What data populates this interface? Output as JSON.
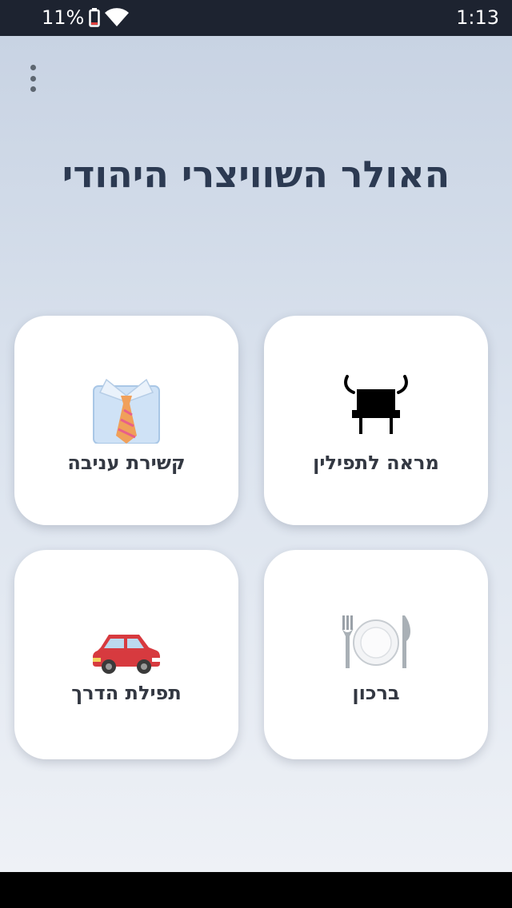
{
  "status_bar": {
    "battery_percent": "11%",
    "time": "1:13",
    "icons": [
      "battery-icon",
      "wifi-icon"
    ]
  },
  "app": {
    "title": "האולר השוויצרי היהודי",
    "menu_icon": "more-vert-icon"
  },
  "cards": [
    {
      "label": "מראה לתפילין",
      "icon": "tefillin-icon"
    },
    {
      "label": "קשירת עניבה",
      "icon": "shirt-tie-icon"
    },
    {
      "label": "ברכון",
      "icon": "plate-cutlery-icon"
    },
    {
      "label": "תפילת הדרך",
      "icon": "car-icon"
    }
  ],
  "colors": {
    "status_bar_bg": "#1d2330",
    "title_color": "#2c3a52",
    "card_bg": "#ffffff",
    "car_red": "#d73a3f"
  }
}
